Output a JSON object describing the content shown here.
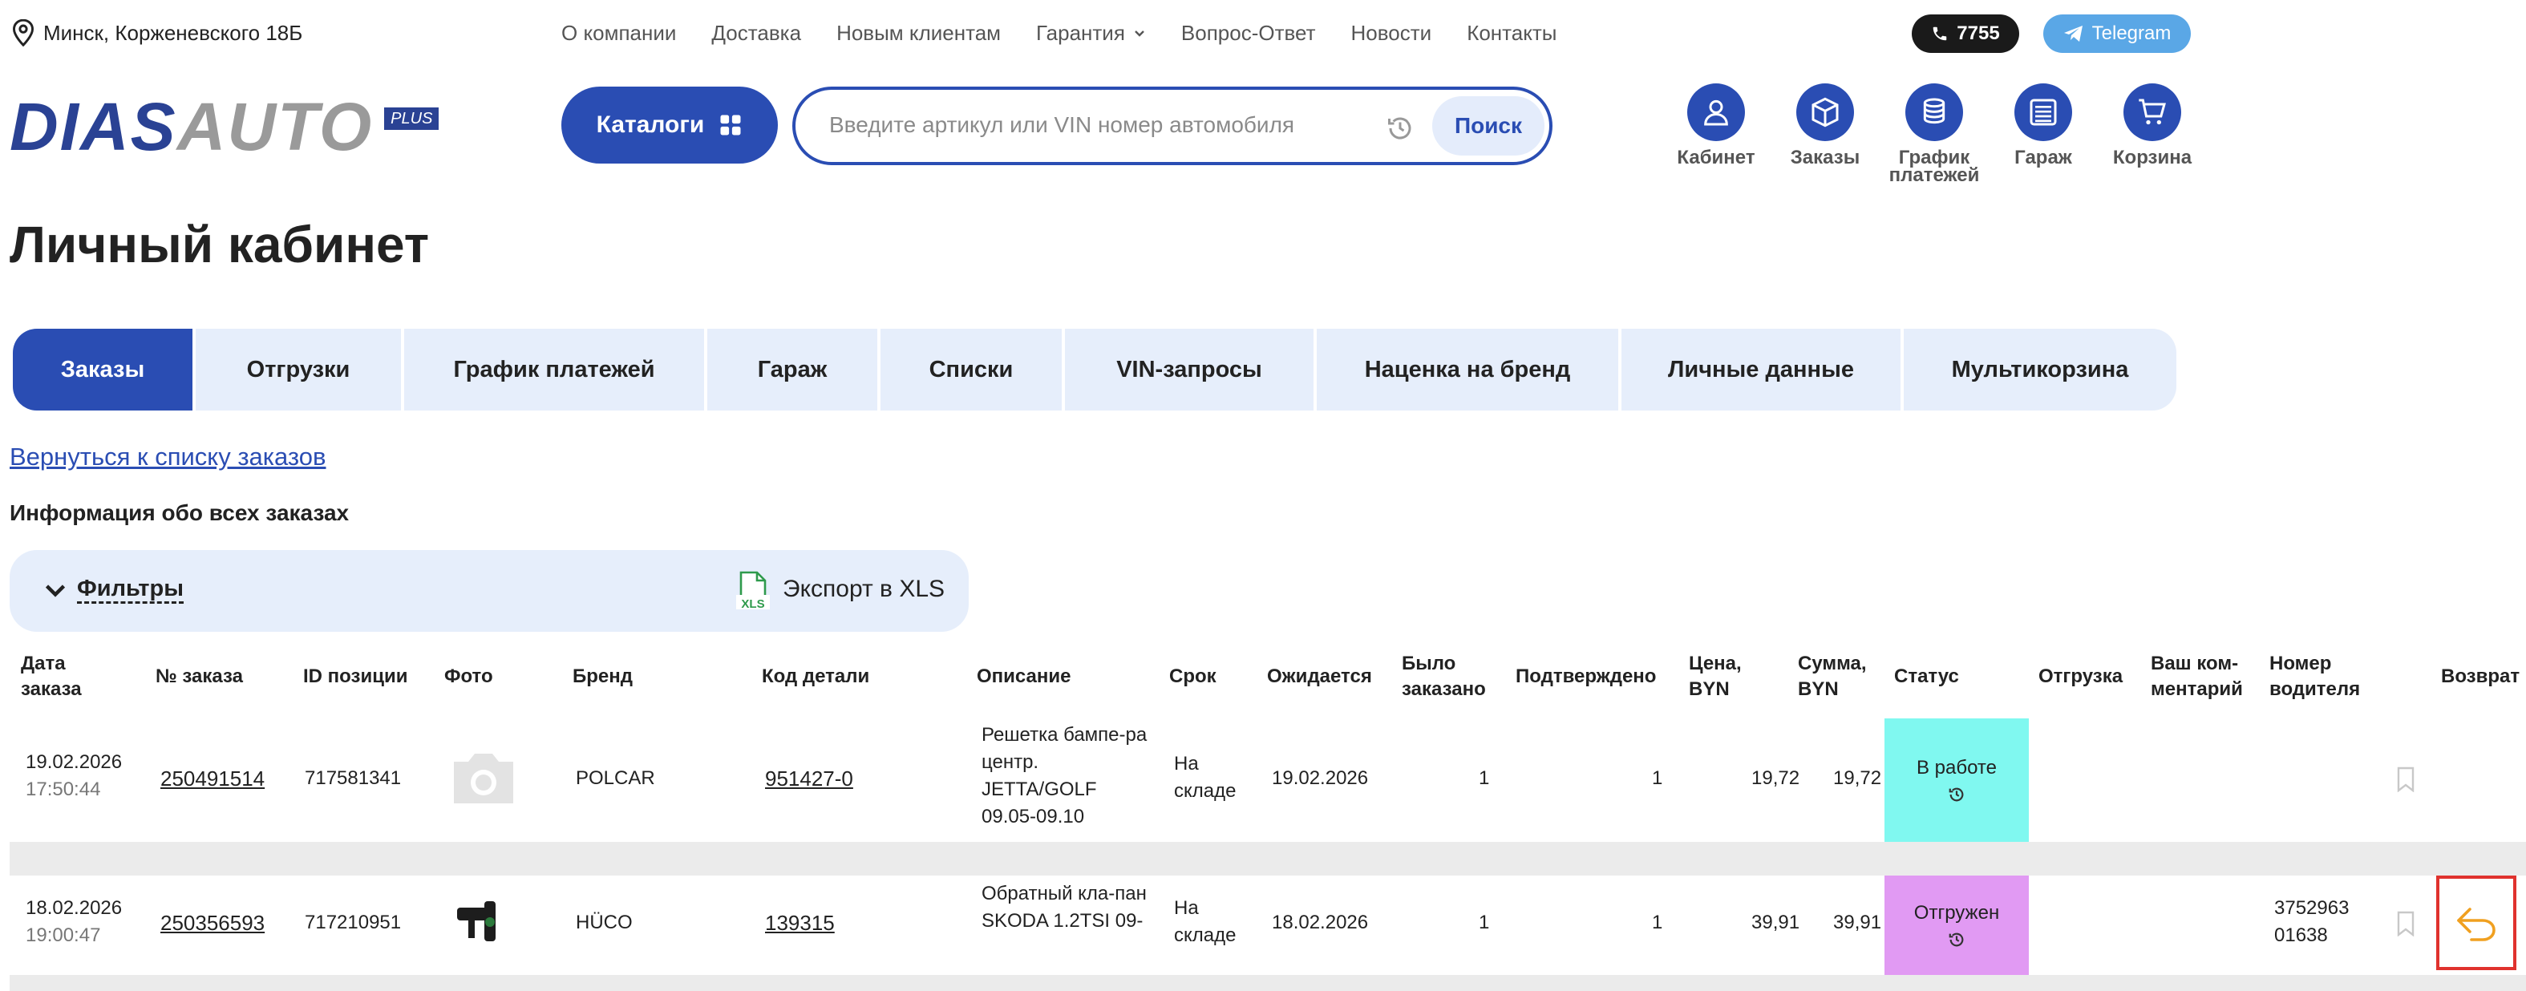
{
  "topbar": {
    "location": "Минск, Корженевского 18Б",
    "nav": [
      "О компании",
      "Доставка",
      "Новым клиентам",
      "Гарантия",
      "Вопрос-Ответ",
      "Новости",
      "Контакты"
    ],
    "phone": "7755",
    "telegram": "Telegram"
  },
  "header": {
    "logo_main": "DIAS",
    "logo_second": "AUTO",
    "logo_badge": "PLUS",
    "catalog_label": "Каталоги",
    "search_placeholder": "Введите артикул или VIN номер автомобиля",
    "search_button": "Поиск",
    "icons": [
      {
        "label": "Кабинет",
        "icon": "user-icon"
      },
      {
        "label": "Заказы",
        "icon": "box-icon"
      },
      {
        "label": "График платежей",
        "icon": "coins-icon"
      },
      {
        "label": "Гараж",
        "icon": "garage-icon"
      },
      {
        "label": "Корзина",
        "icon": "cart-icon"
      }
    ]
  },
  "page": {
    "title": "Личный кабинет",
    "tabs": [
      "Заказы",
      "Отгрузки",
      "График платежей",
      "Гараж",
      "Списки",
      "VIN-запросы",
      "Наценка на бренд",
      "Личные данные",
      "Мультикорзина"
    ],
    "active_tab": "Заказы",
    "back_link": "Вернуться к списку заказов",
    "info_heading": "Информация обо всех заказах",
    "filters_label": "Фильтры",
    "export_label": "Экспорт в XLS",
    "export_icon_text": "XLS"
  },
  "table": {
    "headers": [
      "Дата заказа",
      "№ заказа",
      "ID позиции",
      "Фото",
      "Бренд",
      "Код детали",
      "Описание",
      "Срок",
      "Ожидается",
      "Было заказано",
      "Подтверждено",
      "Цена, BYN",
      "Сумма, BYN",
      "Статус",
      "Отгрузка",
      "Ваш ком-ментарий",
      "Номер водителя",
      "Возврат"
    ],
    "rows": [
      {
        "date": "19.02.2026",
        "time": "17:50:44",
        "order_no": "250491514",
        "position_id": "717581341",
        "photo": "placeholder-camera",
        "brand": "POLCAR",
        "part_code": "951427-0",
        "description": "Решетка бампе-ра центр. JETTA/GOLF 09.05-09.10",
        "term": "На складе",
        "expected": "19.02.2026",
        "ordered": "1",
        "confirmed": "1",
        "price": "19,72",
        "sum": "19,72",
        "status": "В работе",
        "status_color": "#80f8f0",
        "shipment": "",
        "comment": "",
        "driver_phone": "",
        "return_available": false
      },
      {
        "date": "18.02.2026",
        "time": "19:00:47",
        "order_no": "250356593",
        "position_id": "717210951",
        "photo": "part-photo",
        "brand": "HÜCO",
        "part_code": "139315",
        "description": "Обратный кла-пан SKODA 1.2TSI 09-",
        "term": "На складе",
        "expected": "18.02.2026",
        "ordered": "1",
        "confirmed": "1",
        "price": "39,91",
        "sum": "39,91",
        "status": "Отгружен",
        "status_color": "#e19af3",
        "shipment": "",
        "comment": "",
        "driver_phone": "3752963 01638",
        "return_available": true
      }
    ]
  },
  "colors": {
    "brand_blue": "#2a4db3",
    "light_blue": "#e6eefb",
    "return_highlight": "#e0322e",
    "return_icon": "#f0a020"
  }
}
